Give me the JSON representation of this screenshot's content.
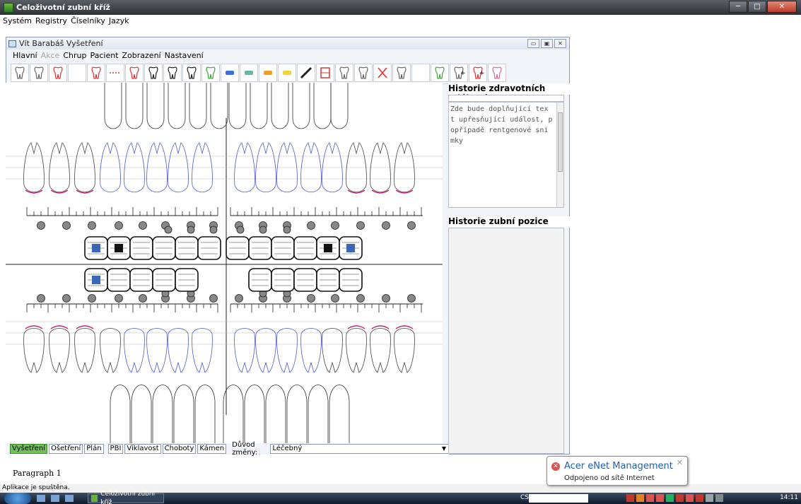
{
  "app": {
    "title": "Celoživotní zubní kříž",
    "menu": [
      "Systém",
      "Registry",
      "Číselníky",
      "Jazyk"
    ]
  },
  "child_window": {
    "title": "Vít Barabáš Vyšetření",
    "menu": [
      {
        "label": "Hlavní",
        "disabled": false
      },
      {
        "label": "Akce",
        "disabled": true
      },
      {
        "label": "Chrup",
        "disabled": false
      },
      {
        "label": "Pacient",
        "disabled": false
      },
      {
        "label": "Zobrazení",
        "disabled": false
      },
      {
        "label": "Nastavení",
        "disabled": false
      }
    ]
  },
  "toolbar_icons": [
    "tooth-gray-icon",
    "tooth-outline-icon",
    "tooth-red-root-icon",
    "blank-icon",
    "tooth-red-crown-icon",
    "bridge-red-icon",
    "root-red-icon",
    "tooth-black-icon",
    "tooth-black-2-icon",
    "tooth-black-3-icon",
    "tooth-green-icon",
    "bar-blue-icon",
    "bar-teal-icon",
    "bar-orange-icon",
    "bar-yellow-icon",
    "line-black-icon",
    "frame-red-icon",
    "tooth-crosshatch-icon",
    "tooth-empty-icon",
    "cross-red-icon",
    "tooth-gap-icon",
    "blank-icon",
    "tooth-green-crown-icon",
    "tooth-plus-icon",
    "tooth-plus-red-icon",
    "tooth-pink-icon"
  ],
  "status_row": {
    "tabs": [
      "Vyšetření",
      "Ošetření",
      "Plán",
      "PBI",
      "Viklavost",
      "Choboty",
      "Kámen"
    ],
    "active_tab": "Vyšetření",
    "reason_label": "Důvod změny:",
    "reason_value": "Léčebný"
  },
  "history_events": {
    "title": "Historie zdravotních událostí",
    "text": "Zde bude doplňující tex t upřesňující událost, p opřípadě rentgenové sni mky"
  },
  "history_position": {
    "title": "Historie zubní pozice"
  },
  "paragraph": "Paragraph 1",
  "app_status": "Aplikace je spuštěna.",
  "balloon": {
    "title": "Acer eNet Management",
    "body": "Odpojeno od sítě Internet"
  },
  "taskbar": {
    "task_label": "Celoživotní zubní kříž",
    "language": "CS",
    "clock": "14:11"
  },
  "colors": {
    "selected_blue": "#3a66b8",
    "selected_black": "#111111",
    "accent_green": "#6fc15a",
    "gum_magenta": "#c0287e",
    "primary_tooth_blue": "#4b5bd2"
  }
}
